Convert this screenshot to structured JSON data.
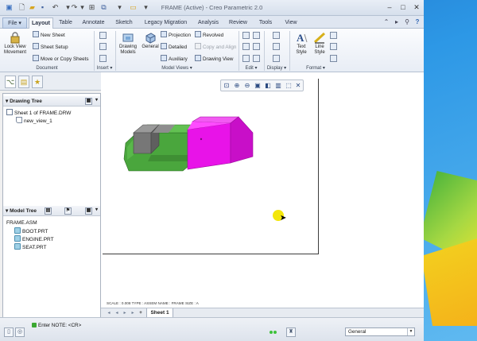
{
  "window": {
    "title": "FRAME (Active) - Creo Parametric 2.0",
    "controls": {
      "minimize": "–",
      "maximize": "□",
      "close": "✕"
    }
  },
  "quick_access": [
    "new-icon",
    "open-icon",
    "save-icon",
    "undo-icon",
    "redo-icon",
    "regenerate-icon",
    "windows-icon",
    "close-window-icon"
  ],
  "tabs": [
    {
      "label": "File ▾"
    },
    {
      "label": "Layout",
      "active": true
    },
    {
      "label": "Table"
    },
    {
      "label": "Annotate"
    },
    {
      "label": "Sketch"
    },
    {
      "label": "Legacy Migration"
    },
    {
      "label": "Analysis"
    },
    {
      "label": "Review"
    },
    {
      "label": "Tools"
    },
    {
      "label": "View"
    }
  ],
  "ribbon": {
    "lock_view_movement": "Lock View Movement",
    "new_sheet": "New Sheet",
    "sheet_setup": "Sheet Setup",
    "move_copy_sheets": "Move or Copy Sheets",
    "drawing_models": "Drawing Models",
    "general": "General",
    "projection": "Projection",
    "detailed": "Detailed",
    "auxiliary": "Auxiliary",
    "revolved": "Revolved",
    "copy_and_align": "Copy and Align",
    "drawing_view": "Drawing View",
    "text_style": "Text Style",
    "line_style": "Line Style",
    "groups": {
      "document": "Document",
      "insert": "Insert ▾",
      "model_views": "Model Views ▾",
      "edit": "Edit ▾",
      "display": "Display ▾",
      "format": "Format ▾"
    }
  },
  "drawing_tree": {
    "title": "Drawing Tree",
    "items": [
      "Sheet 1 of FRAME.DRW",
      "new_view_1"
    ]
  },
  "model_tree": {
    "title": "Model Tree",
    "root": "FRAME.ASM",
    "items": [
      "BOOT.PRT",
      "ENGINE.PRT",
      "SEAT.PRT"
    ]
  },
  "sheet_status": "SCALE : 0.008    TYPE : ASSEM    NAME : FRAME    SIZE : A",
  "sheet_tab": "Sheet 1",
  "status": {
    "message": "Enter NOTE:    <CR>",
    "filter": "General"
  },
  "colors": {
    "accent": "#2d98e6",
    "part_magenta": "#e813e8",
    "part_green": "#4caf3f",
    "part_gray": "#7c7c7c"
  }
}
